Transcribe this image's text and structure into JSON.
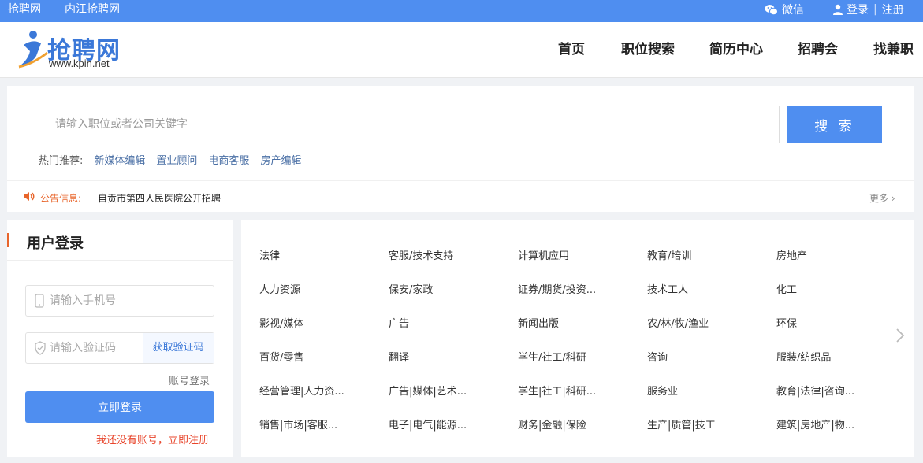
{
  "topbar": {
    "left_links": [
      "抢聘网",
      "内江抢聘网"
    ],
    "wechat_label": "微信",
    "login_label": "登录",
    "separator": "|",
    "register_label": "注册"
  },
  "header": {
    "logo_brand": "抢聘网",
    "logo_url": "www.kpin.net",
    "nav": [
      "首页",
      "职位搜索",
      "简历中心",
      "招聘会",
      "找兼职"
    ]
  },
  "search": {
    "placeholder": "请输入职位或者公司关键字",
    "button_label": "搜 索",
    "hot_label": "热门推荐:",
    "hot_keywords": [
      "新媒体编辑",
      "置业顾问",
      "电商客服",
      "房产编辑"
    ]
  },
  "notice": {
    "label": "公告信息:",
    "text": "自贡市第四人民医院公开招聘",
    "more": "更多 ›"
  },
  "login_panel": {
    "title": "用户登录",
    "phone_placeholder": "请输入手机号",
    "code_placeholder": "请输入验证码",
    "get_code_label": "获取验证码",
    "account_login": "账号登录",
    "login_button": "立即登录",
    "register_link": "我还没有账号，立即注册"
  },
  "categories": [
    [
      "法律",
      "客服/技术支持",
      "计算机应用",
      "教育/培训",
      "房地产"
    ],
    [
      "人力资源",
      "保安/家政",
      "证券/期货/投资...",
      "技术工人",
      "化工"
    ],
    [
      "影视/媒体",
      "广告",
      "新闻出版",
      "农/林/牧/渔业",
      "环保"
    ],
    [
      "百货/零售",
      "翻译",
      "学生/社工/科研",
      "咨询",
      "服装/纺织品"
    ],
    [
      "经营管理|人力资...",
      "广告|媒体|艺术...",
      "学生|社工|科研...",
      "服务业",
      "教育|法律|咨询..."
    ],
    [
      "销售|市场|客服...",
      "电子|电气|能源...",
      "财务|金融|保险",
      "生产|质管|技工",
      "建筑|房地产|物..."
    ]
  ],
  "colors": {
    "primary": "#4f8ef0",
    "accent": "#e8652b",
    "link": "#4a6fa5"
  }
}
